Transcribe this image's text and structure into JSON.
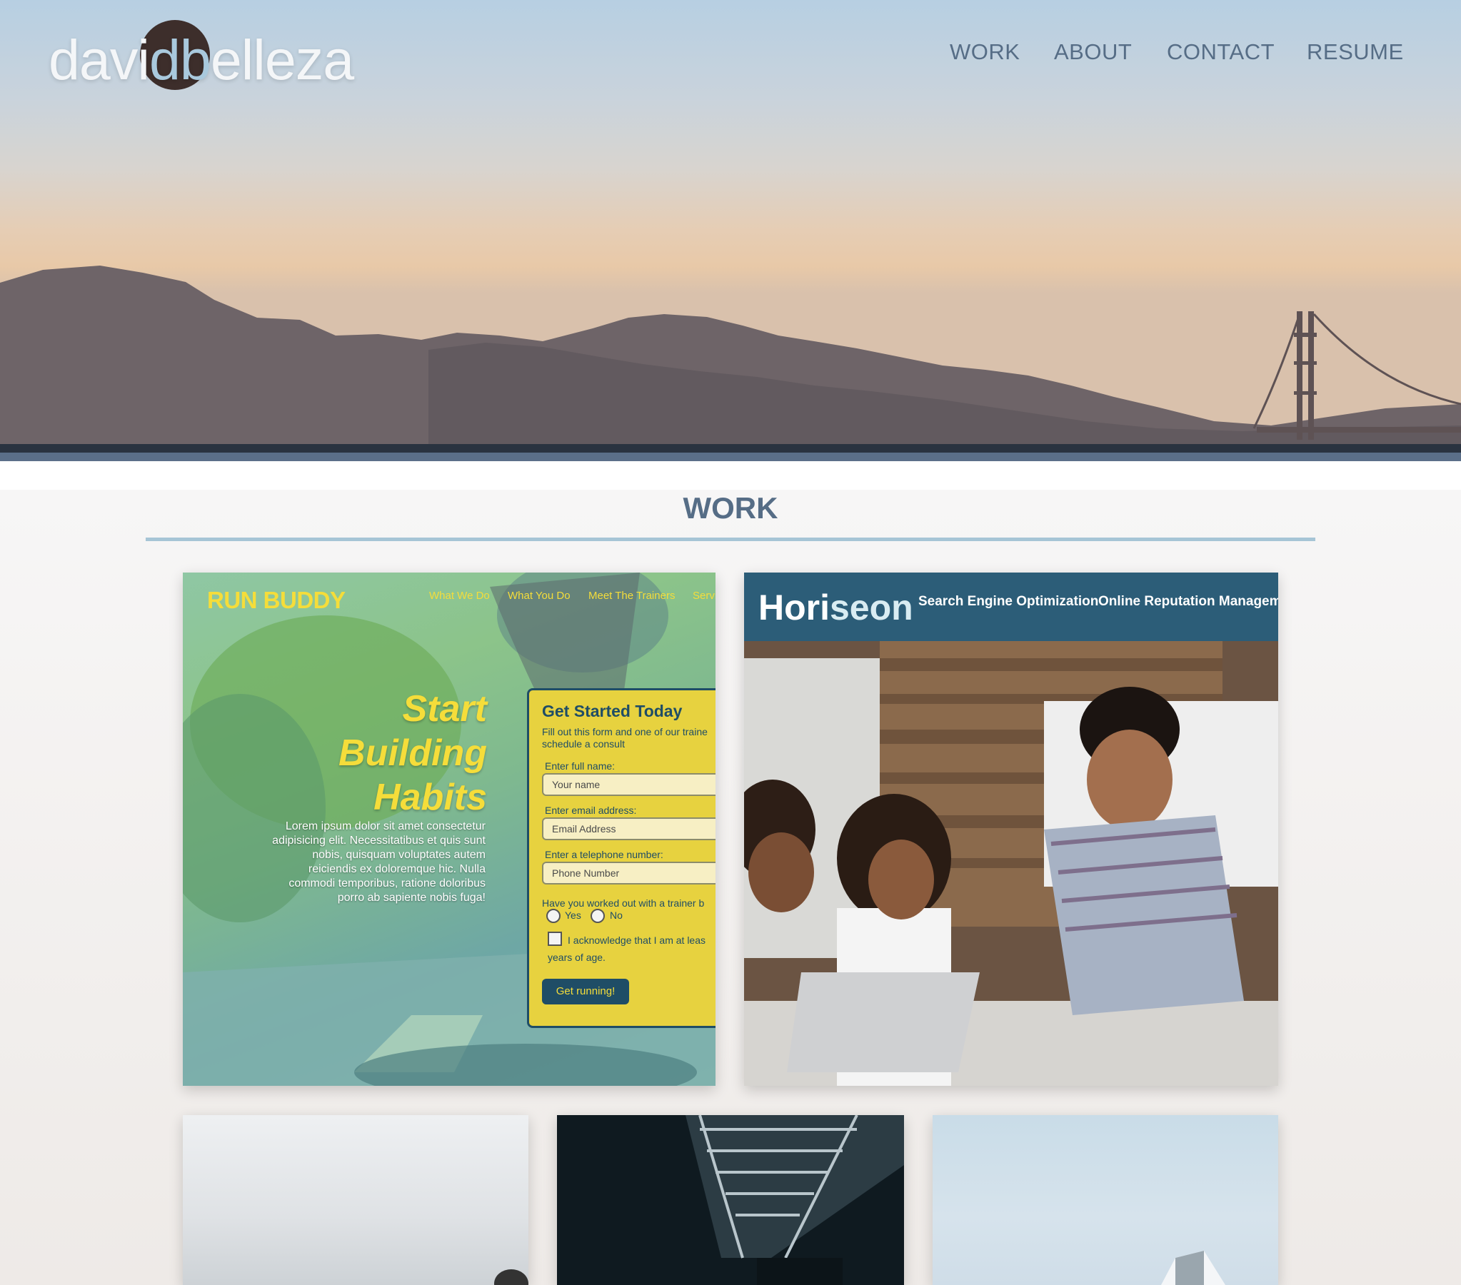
{
  "site": {
    "logo_prefix": "davi",
    "logo_mid": "db",
    "logo_suffix": "elleza"
  },
  "nav": {
    "items": [
      {
        "label": "WORK"
      },
      {
        "label": "ABOUT"
      },
      {
        "label": "CONTACT"
      },
      {
        "label": "RESUME"
      }
    ]
  },
  "work": {
    "title": "WORK",
    "projects": [
      {
        "logo": "RUN BUDDY",
        "nav": [
          "What We Do",
          "What You Do",
          "Meet The Trainers",
          "Servi"
        ],
        "headline": [
          "Start",
          "Building",
          "Habits"
        ],
        "body": "Lorem ipsum dolor sit amet consectetur adipisicing elit. Necessitatibus et quis sunt nobis, quisquam voluptates autem reiciendis ex doloremque hic. Nulla commodi temporibus, ratione doloribus porro ab sapiente nobis fuga!",
        "form": {
          "title": "Get Started Today",
          "subtitle": "Fill out this form and one of our traine schedule a consult",
          "name_label": "Enter full name:",
          "name_placeholder": "Your name",
          "email_label": "Enter email address:",
          "email_placeholder": "Email Address",
          "phone_label": "Enter a telephone number:",
          "phone_placeholder": "Phone Number",
          "question": "Have you worked out with a trainer b",
          "yes": "Yes",
          "no": "No",
          "ack_line1": "I acknowledge that I am at leas",
          "ack_line2": "years of age.",
          "button": "Get running!"
        }
      },
      {
        "logo_a": "Hori",
        "logo_b": "seon",
        "nav": [
          "Search Engine Optimization",
          "Online Reputation Managemen"
        ]
      }
    ]
  },
  "colors": {
    "accent_blue": "#566d86",
    "rule_blue": "#a6c5d6",
    "runbuddy_yellow": "#f5dd3a",
    "horiseon_blue": "#2c5d78"
  }
}
